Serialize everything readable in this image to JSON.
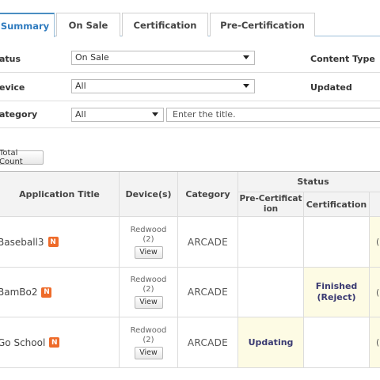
{
  "tabs": [
    {
      "label": "Summary",
      "active": true
    },
    {
      "label": "On Sale",
      "active": false
    },
    {
      "label": "Certification",
      "active": false
    },
    {
      "label": "Pre-Certification",
      "active": false
    }
  ],
  "filters": {
    "status_label": "atus",
    "status_value": "On Sale",
    "device_label": "evice",
    "device_value": "All",
    "category_label": "ategory",
    "category_value": "All",
    "title_placeholder": "Enter the title.",
    "content_type_label": "Content Type",
    "updated_label": "Updated"
  },
  "total_count_button": "Total Count",
  "table": {
    "headers": {
      "title": "Application Title",
      "devices": "Device(s)",
      "category": "Category",
      "status": "Status",
      "pre_certification": "Pre-Certification",
      "certification": "Certification"
    },
    "rows": [
      {
        "title": "Baseball3",
        "badge": "N",
        "device_name": "Redwood",
        "device_count": "(2)",
        "view": "View",
        "category": "ARCADE",
        "pre_cert": "",
        "cert": "",
        "edge": "(l"
      },
      {
        "title": "BamBo2",
        "badge": "N",
        "device_name": "Redwood",
        "device_count": "(2)",
        "view": "View",
        "category": "ARCADE",
        "pre_cert": "",
        "cert": "Finished (Reject)",
        "edge": "(l"
      },
      {
        "title": "Go School",
        "badge": "N",
        "device_name": "Redwood",
        "device_count": "(2)",
        "view": "View",
        "category": "ARCADE",
        "pre_cert": "Updating",
        "cert": "",
        "edge": "(l"
      }
    ]
  },
  "colors": {
    "accent": "#2f7bbf",
    "badge": "#ee6b2a",
    "highlight": "#fdfbe4"
  }
}
